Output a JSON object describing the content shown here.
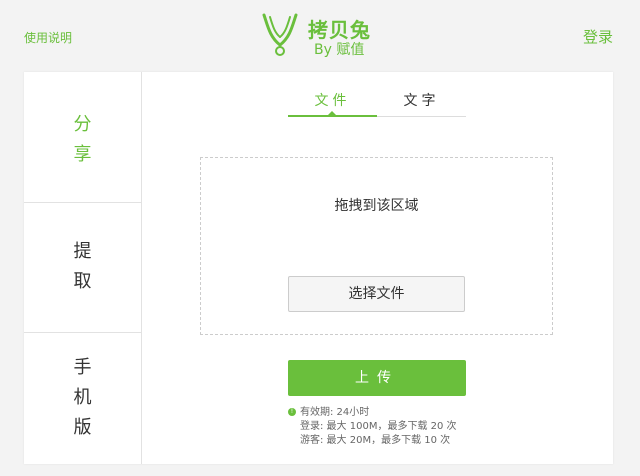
{
  "header": {
    "help_link": "使用说明",
    "brand_name": "拷贝兔",
    "brand_sub": "By 赋值",
    "login_link": "登录",
    "logo_icon": "rabbit-ears-icon"
  },
  "sidebar": {
    "items": [
      {
        "label_lines": [
          "分",
          "享"
        ],
        "active": true
      },
      {
        "label_lines": [
          "提",
          "取"
        ],
        "active": false
      },
      {
        "label_lines": [
          "手",
          "机",
          "版"
        ],
        "active": false
      }
    ]
  },
  "tabs": [
    {
      "label": "文件",
      "active": true
    },
    {
      "label": "文字",
      "active": false
    }
  ],
  "dropzone": {
    "hint": "拖拽到该区域",
    "choose_button": "选择文件"
  },
  "upload_button": "上传",
  "info": {
    "icon": "info-icon",
    "lines": [
      "有效期: 24小时",
      "登录: 最大 100M，最多下载 20 次",
      "游客: 最大 20M，最多下载 10 次"
    ]
  },
  "colors": {
    "accent": "#6abf3c",
    "background": "#f3f3f3"
  }
}
